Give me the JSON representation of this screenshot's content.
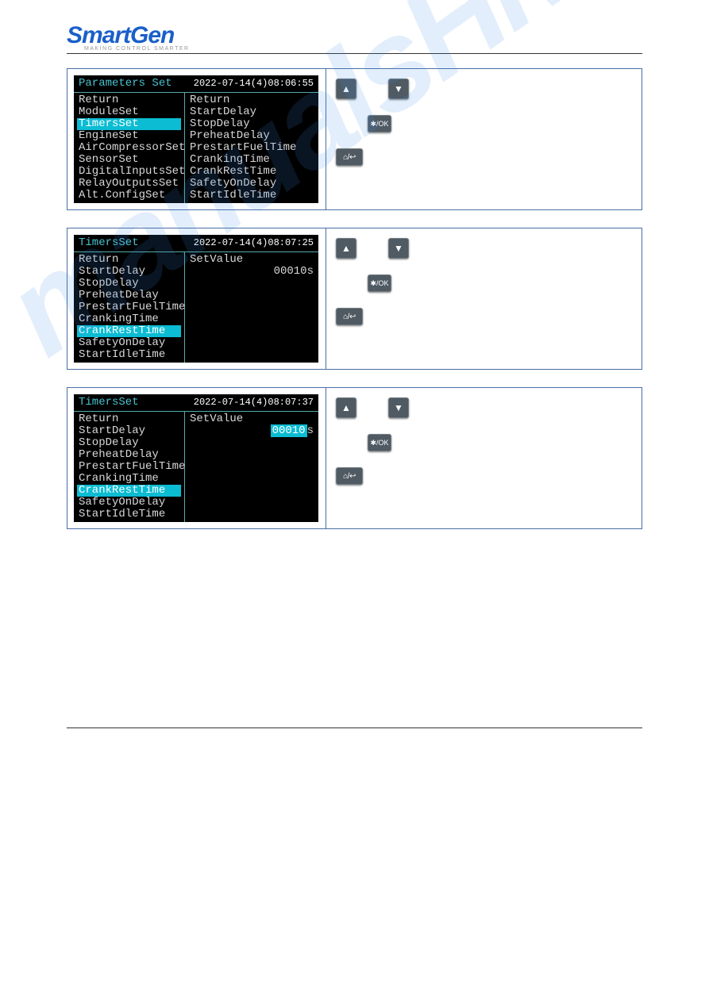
{
  "brand": {
    "name": "SmartGen",
    "tagline": "MAKING CONTROL SMARTER"
  },
  "watermark_text": "manualsHive.com SmartGen",
  "sections": [
    {
      "lcd": {
        "title": "Parameters Set",
        "timestamp": "2022-07-14(4)08:06:55",
        "col1": [
          "Return",
          "ModuleSet",
          "TimersSet",
          "EngineSet",
          "AirCompressorSet",
          "SensorSet",
          "DigitalInputsSet",
          "RelayOutputsSet",
          "Alt.ConfigSet"
        ],
        "col1_hl_index": 2,
        "col2": [
          "Return",
          "StartDelay",
          "StopDelay",
          "PreheatDelay",
          "PrestartFuelTime",
          "CrankingTime",
          "CrankRestTime",
          "SafetyOnDelay",
          "StartIdleTime"
        ]
      },
      "buttons": {
        "up": "▲",
        "down": "▼",
        "ok": "✱/OK",
        "back": "⌂/↩"
      }
    },
    {
      "lcd": {
        "title": "TimersSet",
        "timestamp": "2022-07-14(4)08:07:25",
        "col1": [
          "Return",
          "StartDelay",
          "StopDelay",
          "PreheatDelay",
          "PrestartFuelTime",
          "CrankingTime",
          "CrankRestTime",
          "SafetyOnDelay",
          "StartIdleTime"
        ],
        "col1_hl_index": 6,
        "set_label": "SetValue",
        "set_value": "00010",
        "set_unit": "s",
        "editing": false
      },
      "buttons": {
        "up": "▲",
        "down": "▼",
        "ok": "✱/OK",
        "back": "⌂/↩"
      }
    },
    {
      "lcd": {
        "title": "TimersSet",
        "timestamp": "2022-07-14(4)08:07:37",
        "col1": [
          "Return",
          "StartDelay",
          "StopDelay",
          "PreheatDelay",
          "PrestartFuelTime",
          "CrankingTime",
          "CrankRestTime",
          "SafetyOnDelay",
          "StartIdleTime"
        ],
        "col1_hl_index": 6,
        "set_label": "SetValue",
        "set_value": "00010",
        "set_unit": "s",
        "editing": true
      },
      "buttons": {
        "up": "▲",
        "down": "▼",
        "ok": "✱/OK",
        "back": "⌂/↩"
      }
    }
  ]
}
